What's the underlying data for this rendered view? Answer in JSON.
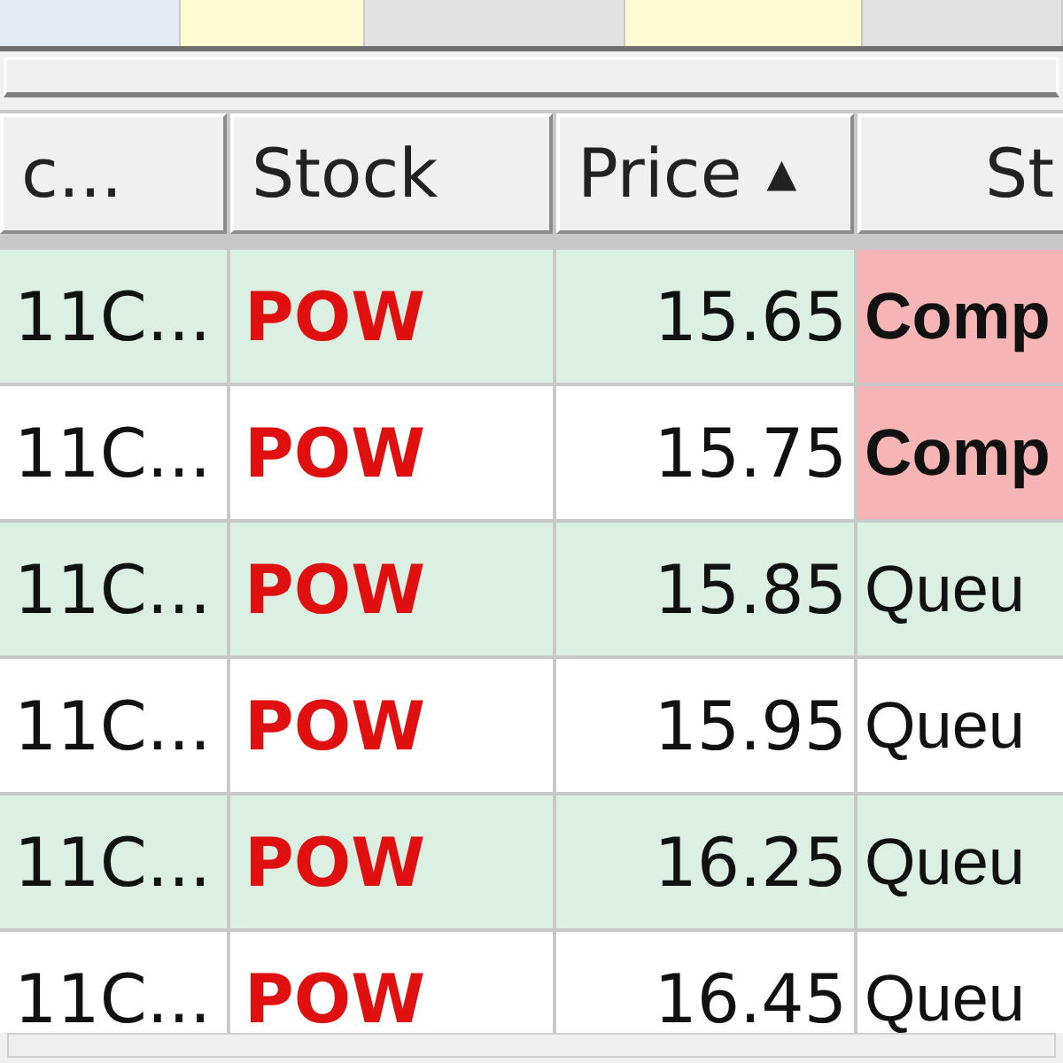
{
  "table": {
    "columns": [
      {
        "label": "c..."
      },
      {
        "label": "Stock"
      },
      {
        "label": "Price",
        "sorted": true,
        "sort_icon": "▲"
      },
      {
        "label": "St"
      }
    ],
    "rows": [
      {
        "account": "11C...",
        "stock": "POW",
        "price": "15.65",
        "status": {
          "text": "Comp",
          "kind": "completed"
        }
      },
      {
        "account": "11C...",
        "stock": "POW",
        "price": "15.75",
        "status": {
          "text": "Comp",
          "kind": "completed"
        }
      },
      {
        "account": "11C...",
        "stock": "POW",
        "price": "15.85",
        "status": {
          "text": "Queu",
          "kind": "queued"
        }
      },
      {
        "account": "11C...",
        "stock": "POW",
        "price": "15.95",
        "status": {
          "text": "Queu",
          "kind": "queued"
        }
      },
      {
        "account": "11C...",
        "stock": "POW",
        "price": "16.25",
        "status": {
          "text": "Queu",
          "kind": "queued"
        }
      },
      {
        "account": "11C...",
        "stock": "POW",
        "price": "16.45",
        "status": {
          "text": "Queu",
          "kind": "queued"
        }
      }
    ]
  }
}
